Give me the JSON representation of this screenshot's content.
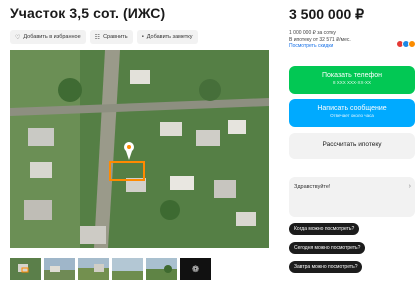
{
  "listing": {
    "title": "Участок 3,5 сот. (ИЖС)",
    "price": "3 500 000 ₽",
    "price_per_unit": "1 000 000 ₽ за сотку",
    "mortgage_info": "В ипотеку от 32 571 ₽/мес.",
    "details_link": "Посмотреть скидки"
  },
  "actions": {
    "favorite": "Добавить в избранное",
    "compare": "Сравнить",
    "note": "Добавить заметку"
  },
  "contact": {
    "phone_label": "Показать телефон",
    "phone_masked": "8 XXX XXX-XX-XX",
    "message_label": "Написать сообщение",
    "message_sub": "Отвечает около часа",
    "mortgage_label": "Рассчитать ипотеку"
  },
  "chat": {
    "greeting": "Здравствуйте!",
    "quick_replies": [
      "Когда можно посмотреть?",
      "Сегодня можно посмотреть?",
      "Завтра можно посмотреть?"
    ]
  },
  "gallery": {
    "thumbnail_count": 6
  },
  "colors": {
    "phone_button": "#02c854",
    "message_button": "#00aaff",
    "plot_highlight": "#ff8a00"
  }
}
